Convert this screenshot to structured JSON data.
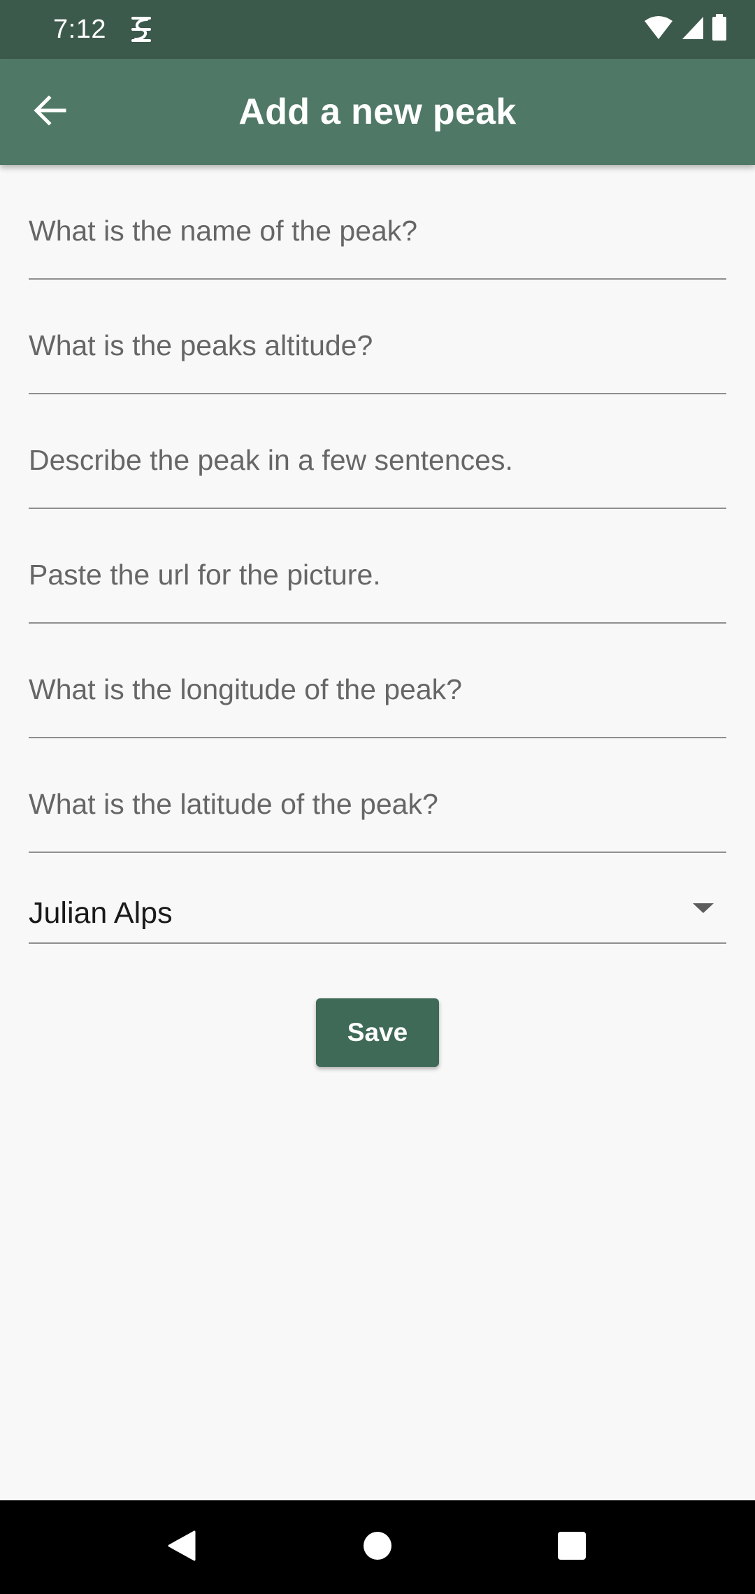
{
  "status_bar": {
    "time": "7:12",
    "app_icon": "notification-s-icon",
    "wifi_icon": "wifi-icon",
    "signal_icon": "cell-signal-icon",
    "battery_icon": "battery-icon"
  },
  "app_bar": {
    "title": "Add a new peak",
    "back_icon": "arrow-back-icon"
  },
  "form": {
    "name_placeholder": "What is the name of the peak?",
    "altitude_placeholder": "What is the peaks altitude?",
    "description_placeholder": "Describe the peak in a few sentences.",
    "picture_url_placeholder": "Paste the url for the picture.",
    "longitude_placeholder": "What is the longitude of the peak?",
    "latitude_placeholder": "What is the latitude of the peak?",
    "mountain_range_selected": "Julian Alps",
    "dropdown_icon": "arrow-drop-down-icon"
  },
  "save_button": {
    "label": "Save"
  },
  "nav_bar": {
    "back_icon": "nav-back-icon",
    "home_icon": "nav-home-icon",
    "recents_icon": "nav-recents-icon"
  },
  "colors": {
    "status_bar": "#3c5a4c",
    "app_bar": "#4f7866",
    "button": "#406a58",
    "background": "#f8f8f8"
  }
}
